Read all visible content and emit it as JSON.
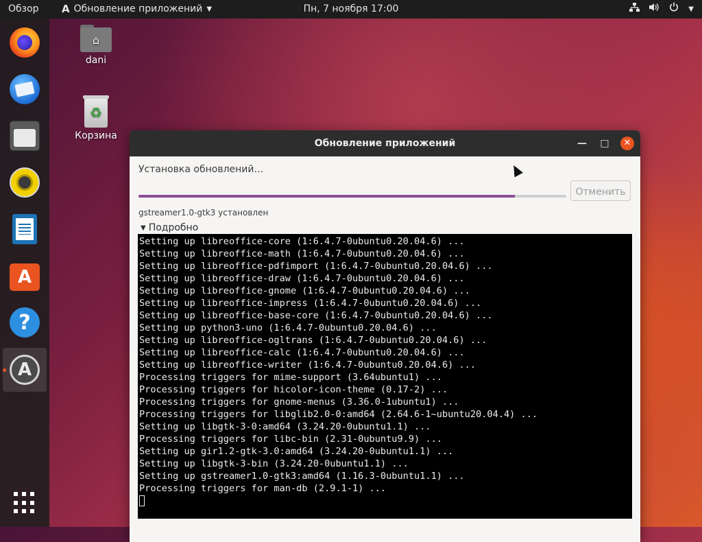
{
  "topbar": {
    "overview": "Обзор",
    "app_icon": "A",
    "app_name": "Обновление приложений",
    "clock": "Пн, 7 ноября  17:00",
    "tray_icons": [
      "network-icon",
      "volume-icon",
      "power-icon",
      "chevron-down-icon"
    ]
  },
  "dock": {
    "apps": [
      "firefox",
      "thunderbird",
      "files",
      "rhythmbox",
      "libreoffice-writer",
      "ubuntu-software",
      "help",
      "software-updater"
    ],
    "active_app": "software-updater",
    "store_glyph": "A",
    "help_glyph": "?",
    "updater_glyph": "A"
  },
  "desktop": {
    "home_label": "dani",
    "trash_label": "Корзина"
  },
  "window": {
    "title": "Обновление приложений",
    "status": "Установка обновлений…",
    "progress_fraction": 0.88,
    "cancel_label": "Отменить",
    "package_status": "gstreamer1.0-gtk3 установлен",
    "details_label": "Подробно",
    "terminal_lines": [
      "Setting up libreoffice-core (1:6.4.7-0ubuntu0.20.04.6) ...",
      "Setting up libreoffice-math (1:6.4.7-0ubuntu0.20.04.6) ...",
      "Setting up libreoffice-pdfimport (1:6.4.7-0ubuntu0.20.04.6) ...",
      "Setting up libreoffice-draw (1:6.4.7-0ubuntu0.20.04.6) ...",
      "Setting up libreoffice-gnome (1:6.4.7-0ubuntu0.20.04.6) ...",
      "Setting up libreoffice-impress (1:6.4.7-0ubuntu0.20.04.6) ...",
      "Setting up libreoffice-base-core (1:6.4.7-0ubuntu0.20.04.6) ...",
      "Setting up python3-uno (1:6.4.7-0ubuntu0.20.04.6) ...",
      "Setting up libreoffice-ogltrans (1:6.4.7-0ubuntu0.20.04.6) ...",
      "Setting up libreoffice-calc (1:6.4.7-0ubuntu0.20.04.6) ...",
      "Setting up libreoffice-writer (1:6.4.7-0ubuntu0.20.04.6) ...",
      "Processing triggers for mime-support (3.64ubuntu1) ...",
      "Processing triggers for hicolor-icon-theme (0.17-2) ...",
      "Processing triggers for gnome-menus (3.36.0-1ubuntu1) ...",
      "Processing triggers for libglib2.0-0:amd64 (2.64.6-1~ubuntu20.04.4) ...",
      "Setting up libgtk-3-0:amd64 (3.24.20-0ubuntu1.1) ...",
      "Processing triggers for libc-bin (2.31-0ubuntu9.9) ...",
      "Setting up gir1.2-gtk-3.0:amd64 (3.24.20-0ubuntu1.1) ...",
      "Setting up libgtk-3-bin (3.24.20-0ubuntu1.1) ...",
      "Setting up gstreamer1.0-gtk3:amd64 (1.16.3-0ubuntu1.1) ...",
      "Processing triggers for man-db (2.9.1-1) ..."
    ]
  }
}
